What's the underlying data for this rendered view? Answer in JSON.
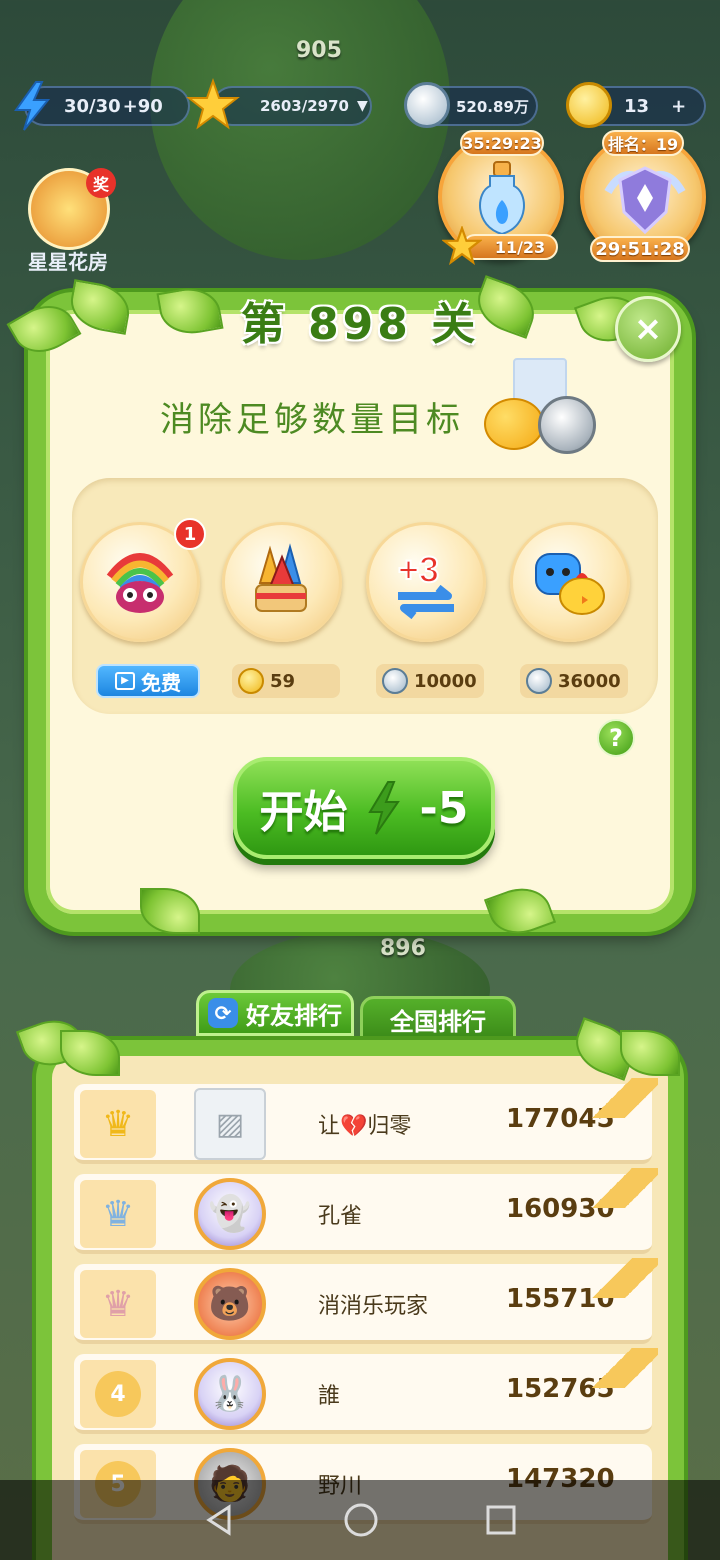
{
  "hud": {
    "energy": "30/30",
    "energy_bonus": "+90",
    "stars": "2603/2970",
    "silver": "520.89万",
    "gold": "13"
  },
  "background": {
    "level_top": "905",
    "level_bottom": "896",
    "garden_label": "星星花房",
    "garden_badge": "奖"
  },
  "events": {
    "potion_timer": "35:29:23",
    "potion_progress": "11/23",
    "rank_label": "排名：19",
    "rank_timer": "29:51:28"
  },
  "dialog": {
    "title": "第 898 关",
    "goal": "消除足够数量目标",
    "close": "×",
    "boosters": [
      {
        "name": "rainbow-owl",
        "badge": "1",
        "price_label": "免费"
      },
      {
        "name": "firework",
        "price": "59"
      },
      {
        "name": "plus-three-moves",
        "price": "10000"
      },
      {
        "name": "animal-pair",
        "price": "36000"
      }
    ],
    "help": "?",
    "start_label": "开始",
    "start_cost": "-5"
  },
  "ranking": {
    "tabs": [
      "好友排行",
      "全国排行"
    ],
    "rows": [
      {
        "rank": "1",
        "name": "让💔归零",
        "score": "177045"
      },
      {
        "rank": "2",
        "name": "孔雀",
        "score": "160930"
      },
      {
        "rank": "3",
        "name": "消消乐玩家",
        "score": "155710"
      },
      {
        "rank": "4",
        "name": "誰",
        "score": "152765"
      },
      {
        "rank": "5",
        "name": "野川",
        "score": "147320"
      }
    ]
  },
  "colors": {
    "vine_green": "#7cc43a",
    "panel_cream": "#fef8dc",
    "start_green": "#4cbc23",
    "free_blue": "#1d86e0"
  }
}
